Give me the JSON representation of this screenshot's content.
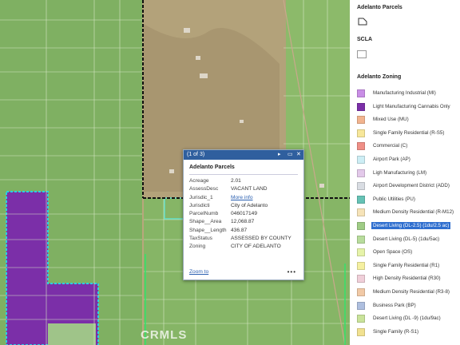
{
  "popup": {
    "header": "(1 of 3)",
    "controls": {
      "next": "▸",
      "dock": "▭",
      "close": "✕"
    },
    "title": "Adelanto Parcels",
    "fields": [
      {
        "key": "Acreage",
        "value": "2.01"
      },
      {
        "key": "AssessDesc",
        "value": "VACANT LAND"
      },
      {
        "key": "Jurisdic_1",
        "value": "More info",
        "link": true
      },
      {
        "key": "Jurisdicti",
        "value": "City of Adelanto"
      },
      {
        "key": "ParcelNumb",
        "value": "046017149"
      },
      {
        "key": "Shape__Area",
        "value": "12,068.87"
      },
      {
        "key": "Shape__Length",
        "value": "436.87"
      },
      {
        "key": "TaxStatus",
        "value": "ASSESSED BY COUNTY"
      },
      {
        "key": "Zoning",
        "value": "CITY OF ADELANTO"
      }
    ],
    "zoom_to": "Zoom to",
    "more": "•••"
  },
  "watermark": "CRMLS",
  "legend": {
    "parcels_title": "Adelanto Parcels",
    "scla_title": "SCLA",
    "zoning_title": "Adelanto Zoning",
    "items": [
      {
        "label": "Manufacturing Industrial (MI)",
        "color": "#c98ee6"
      },
      {
        "label": "Light Manufacturing Cannabis Only",
        "color": "#7b2fa8"
      },
      {
        "label": "Mixed Use (MU)",
        "color": "#f2b48f"
      },
      {
        "label": "Single Family Residential (R-S5)",
        "color": "#f7e79a"
      },
      {
        "label": "Commercial (C)",
        "color": "#ef8f86"
      },
      {
        "label": "Airport Park (AP)",
        "color": "#cdeef5"
      },
      {
        "label": "Ligh Manufacturing (LM)",
        "color": "#e3c9ea"
      },
      {
        "label": "Airport Development District (ADD)",
        "color": "#d9dde3"
      },
      {
        "label": "Public Utilities (PU)",
        "color": "#66c2b5"
      },
      {
        "label": "Medium Density Residential (R-M12)",
        "color": "#f6e3b8"
      },
      {
        "label": "Desert Living (DL-2.5) (1du/2.5 ac)",
        "color": "#9fcc85",
        "selected": true
      },
      {
        "label": "Desert Living (DL-5) (1du/5ac)",
        "color": "#b8dc9c"
      },
      {
        "label": "Open Space (OS)",
        "color": "#e6f3a9"
      },
      {
        "label": "Single Family Residential (R1)",
        "color": "#f5f0a0"
      },
      {
        "label": "High Density Residential (R30)",
        "color": "#f0cfd9"
      },
      {
        "label": "Medium Density Residential (R3-8)",
        "color": "#f1c9a6"
      },
      {
        "label": "Business Park (BP)",
        "color": "#aebfdf"
      },
      {
        "label": "Desert Living (DL -9) (1du/9ac)",
        "color": "#c9e39a"
      },
      {
        "label": "Single Family (R-S1)",
        "color": "#f1e190"
      }
    ]
  }
}
